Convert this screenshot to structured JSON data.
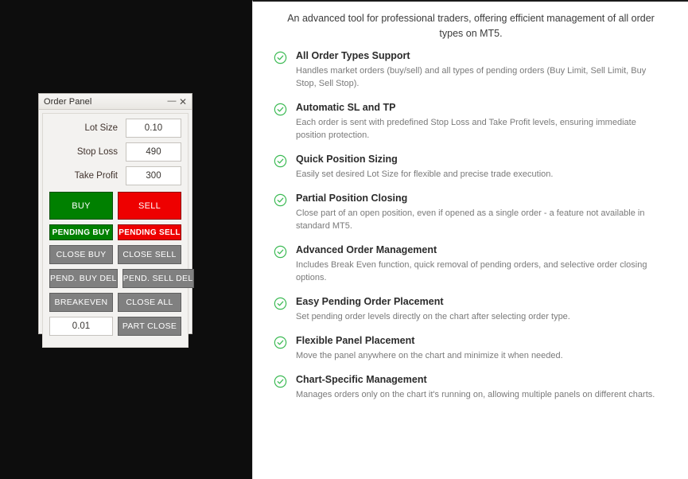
{
  "order_panel": {
    "title": "Order Panel",
    "minimize_label": "—",
    "close_label": "✕",
    "fields": [
      {
        "label": "Lot Size",
        "value": "0.10"
      },
      {
        "label": "Stop Loss",
        "value": "490"
      },
      {
        "label": "Take Profit",
        "value": "300"
      }
    ],
    "buttons": {
      "buy": "BUY",
      "sell": "SELL",
      "pending_buy": "PENDING BUY",
      "pending_sell": "PENDING SELL",
      "close_buy": "CLOSE BUY",
      "close_sell": "CLOSE SELL",
      "pend_buy_del": "PEND. BUY DEL",
      "pend_sell_del": "PEND. SELL DEL",
      "breakeven": "BREAKEVEN",
      "close_all": "CLOSE ALL",
      "part_close": "PART CLOSE"
    },
    "part_close_lot": "0.01",
    "colors": {
      "buy": "#008000",
      "sell": "#ee0000",
      "gray": "#808080"
    }
  },
  "feature_panel": {
    "intro": "An advanced tool for professional traders, offering efficient management of all order types on MT5.",
    "check_icon": "check-circle-icon",
    "accent_color": "#3cba54",
    "features": [
      {
        "title": "All Order Types Support",
        "desc": "Handles market orders (buy/sell) and all types of pending orders (Buy Limit, Sell Limit, Buy Stop, Sell Stop)."
      },
      {
        "title": "Automatic SL and TP",
        "desc": "Each order is sent with predefined Stop Loss and Take Profit levels, ensuring immediate position protection."
      },
      {
        "title": "Quick Position Sizing",
        "desc": "Easily set desired Lot Size for flexible and precise trade execution."
      },
      {
        "title": "Partial Position Closing",
        "desc": "Close part of an open position, even if opened as a single order - a feature not available in standard MT5."
      },
      {
        "title": "Advanced Order Management",
        "desc": "Includes Break Even function, quick removal of pending orders, and selective order closing options."
      },
      {
        "title": "Easy Pending Order Placement",
        "desc": "Set pending order levels directly on the chart after selecting order type."
      },
      {
        "title": "Flexible Panel Placement",
        "desc": "Move the panel anywhere on the chart and minimize it when needed."
      },
      {
        "title": "Chart-Specific Management",
        "desc": "Manages orders only on the chart it's running on, allowing multiple panels on different charts."
      }
    ]
  }
}
